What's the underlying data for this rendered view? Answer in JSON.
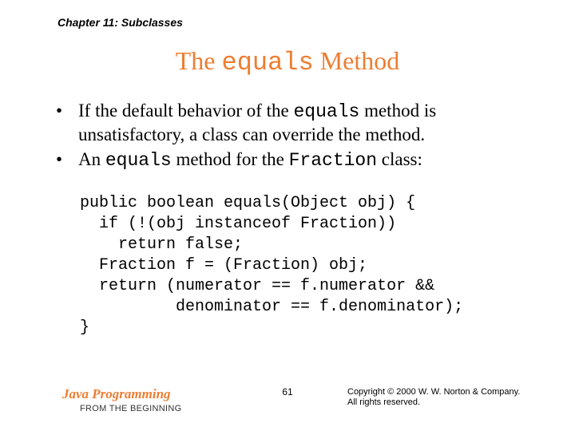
{
  "header": {
    "chapter": "Chapter 11: Subclasses"
  },
  "title": {
    "prefix": "The ",
    "mono": "equals",
    "suffix": " Method"
  },
  "bullets": {
    "b1_p1": "If the default behavior of the ",
    "b1_mono": "equals",
    "b1_p2": " method is unsatisfactory, a class can override the method.",
    "b2_p1": "An ",
    "b2_mono1": "equals",
    "b2_p2": " method for the ",
    "b2_mono2": "Fraction",
    "b2_p3": " class:"
  },
  "code": "public boolean equals(Object obj) {\n  if (!(obj instanceof Fraction))\n    return false;\n  Fraction f = (Fraction) obj;\n  return (numerator == f.numerator &&\n          denominator == f.denominator);\n}",
  "footer": {
    "book": "Java Programming",
    "sub": "FROM THE BEGINNING",
    "page": "61",
    "copyright1": "Copyright © 2000 W. W. Norton & Company.",
    "copyright2": "All rights reserved."
  }
}
